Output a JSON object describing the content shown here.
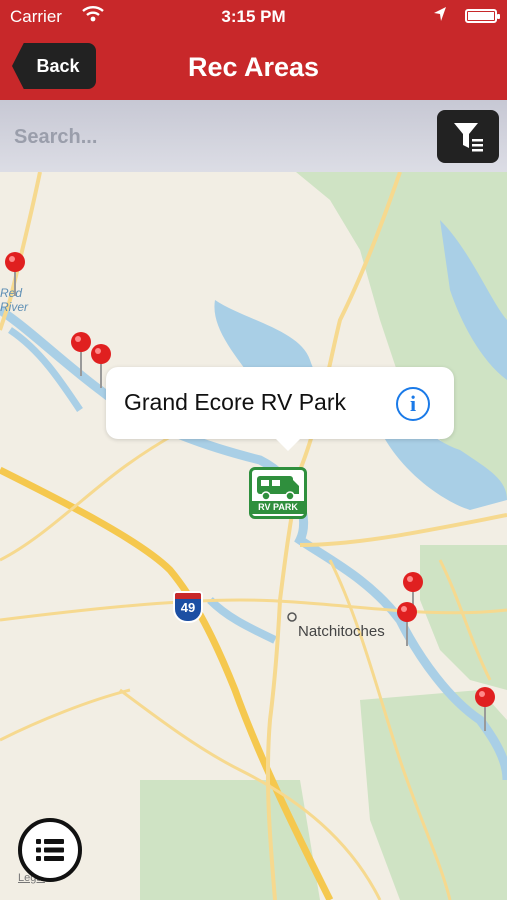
{
  "status_bar": {
    "carrier": "Carrier",
    "time": "3:15 PM"
  },
  "nav": {
    "back_label": "Back",
    "title": "Rec Areas"
  },
  "search": {
    "placeholder": "Search..."
  },
  "map": {
    "callout_title": "Grand Ecore RV Park",
    "rv_marker_label": "RV PARK",
    "interstate_shield": "49",
    "town_label": "Natchitoches",
    "river_label": "Red River",
    "corner_mark": "Legal"
  },
  "colors": {
    "brand_red": "#c8282a",
    "rv_green": "#2f8f3d",
    "info_blue": "#1a7ae8",
    "pin_red": "#e02020"
  },
  "icons": {
    "status_wifi": "wifi-icon",
    "status_location": "location-arrow-icon",
    "status_battery": "battery-icon",
    "filter": "filter-list-icon",
    "info": "info-icon",
    "list": "list-icon",
    "pins": "map-pin-icon"
  }
}
